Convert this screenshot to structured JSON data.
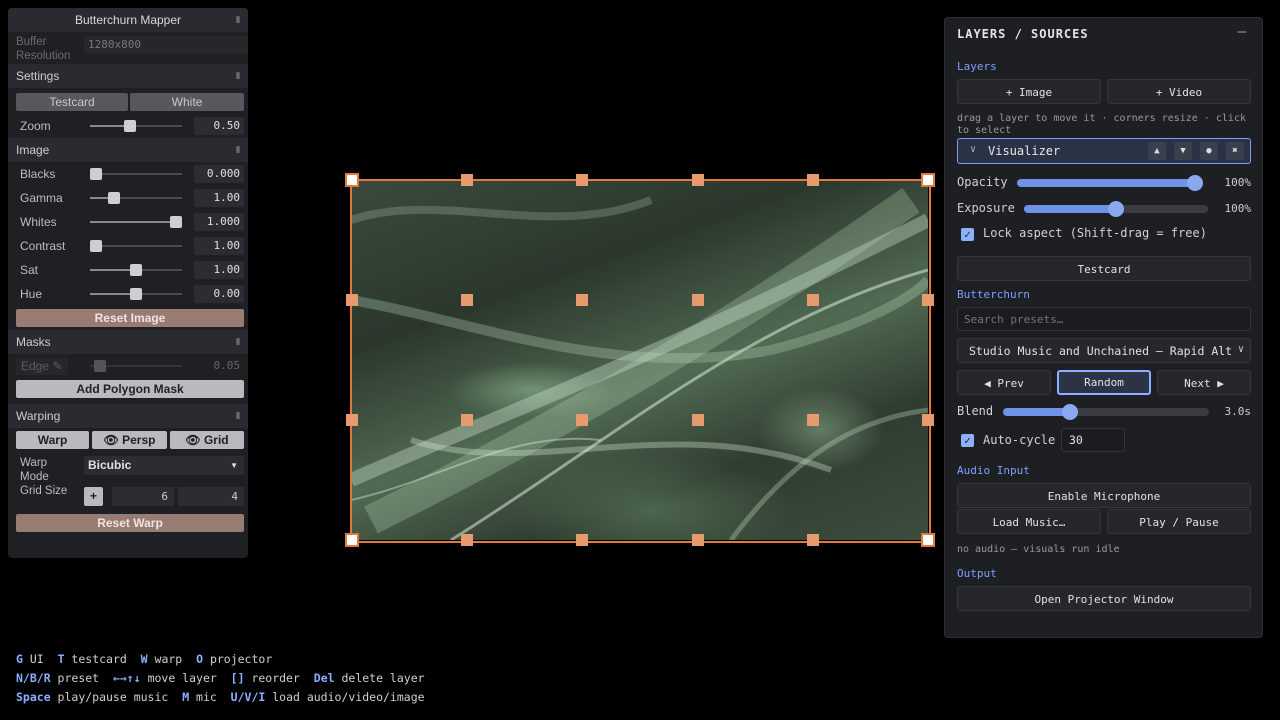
{
  "left_panel": {
    "title": "Butterchurn Mapper",
    "toggle_glyph": "⦀",
    "buffer": {
      "label": "Buffer Resolution",
      "value": "1280x800"
    },
    "settings": {
      "title": "Settings",
      "buttons": [
        "Testcard",
        "White"
      ],
      "zoom": {
        "label": "Zoom",
        "value": "0.50",
        "level": 0.43
      }
    },
    "image": {
      "title": "Image",
      "rows": [
        {
          "label": "Blacks",
          "value": "0.000",
          "level": 0.0
        },
        {
          "label": "Gamma",
          "value": "1.00",
          "level": 0.22
        },
        {
          "label": "Whites",
          "value": "1.000",
          "level": 1.0
        },
        {
          "label": "Contrast",
          "value": "1.00",
          "level": 0.0
        },
        {
          "label": "Sat",
          "value": "1.00",
          "level": 0.5
        },
        {
          "label": "Hue",
          "value": "0.00",
          "level": 0.5
        }
      ],
      "reset": "Reset Image"
    },
    "masks": {
      "title": "Masks",
      "edge_label": "Edge",
      "edge_value": "0.05",
      "add": "Add Polygon Mask"
    },
    "warping": {
      "title": "Warping",
      "tabs": [
        "Warp",
        "Persp",
        "Grid"
      ],
      "mode_label": "Warp Mode",
      "mode_value": "Bicubic",
      "grid_label": "Grid Size",
      "grid_x": "6",
      "grid_y": "4",
      "reset": "Reset Warp"
    }
  },
  "right_panel": {
    "title": "LAYERS / SOURCES",
    "minimize": "—",
    "layers_title": "Layers",
    "add_image": "+ Image",
    "add_video": "+ Video",
    "hint": "drag a layer to move it · corners resize · click to select",
    "layer": {
      "name": "Visualizer",
      "chevron": "∨",
      "controls": [
        "▲",
        "▼",
        "●",
        "✖"
      ]
    },
    "opacity": {
      "label": "Opacity",
      "value": "100%",
      "level": 1.0
    },
    "exposure": {
      "label": "Exposure",
      "value": "100%",
      "level": 0.5
    },
    "lock_aspect": "Lock aspect (Shift-drag = free)",
    "testcard": "Testcard",
    "butterchurn_title": "Butterchurn",
    "search_placeholder": "Search presets…",
    "preset": "Studio Music and Unchained — Rapid Alte",
    "prev": "◀ Prev",
    "random": "Random",
    "next": "Next ▶",
    "blend": {
      "label": "Blend",
      "value": "3.0s",
      "level": 0.31
    },
    "autocycle": {
      "label": "Auto-cycle",
      "value": "30"
    },
    "audio_title": "Audio Input",
    "enable_mic": "Enable Microphone",
    "load_music": "Load Music…",
    "play_pause": "Play / Pause",
    "audio_status": "no audio — visuals run idle",
    "output_title": "Output",
    "open_projector": "Open Projector Window"
  },
  "help": [
    [
      {
        "k": "G",
        "t": " UI  "
      },
      {
        "k": "T",
        "t": " testcard  "
      },
      {
        "k": "W",
        "t": " warp  "
      },
      {
        "k": "O",
        "t": " projector"
      }
    ],
    [
      {
        "k": "N/B/R",
        "t": " preset  "
      },
      {
        "k": "←→↑↓",
        "t": " move layer  "
      },
      {
        "k": "[]",
        "t": " reorder  "
      },
      {
        "k": "Del",
        "t": " delete layer"
      }
    ],
    [
      {
        "k": "Space",
        "t": " play/pause music  "
      },
      {
        "k": "M",
        "t": " mic  "
      },
      {
        "k": "U/V/I",
        "t": " load audio/video/image"
      }
    ]
  ]
}
